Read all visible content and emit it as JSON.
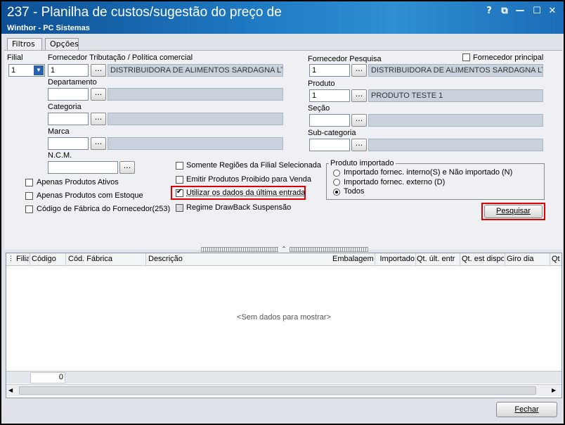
{
  "window": {
    "title": "237 - Planilha de custos/sugestão do preço de",
    "subtitle": "Winthor - PC Sistemas",
    "buttons": [
      "?",
      "⧉",
      "—",
      "☐",
      "✕"
    ]
  },
  "tabs": [
    {
      "label": "Filtros"
    },
    {
      "label": "Opções"
    }
  ],
  "filters": {
    "filial_label": "Filial",
    "filial_value": "1",
    "forn_trib_label": "Fornecedor Tributação / Política comercial",
    "forn_trib_code": "1",
    "forn_trib_name": "DISTRIBUIDORA DE ALIMENTOS SARDAGNA LTDA",
    "departamento_label": "Departamento",
    "categoria_label": "Categoria",
    "marca_label": "Marca",
    "ncm_label": "N.C.M.",
    "forn_pesq_label": "Fornecedor Pesquisa",
    "forn_pesq_code": "1",
    "forn_pesq_name": "DISTRIBUIDORA DE ALIMENTOS SARDAGNA LTDA",
    "forn_principal_label": "Fornecedor principal",
    "produto_label": "Produto",
    "produto_code": "1",
    "produto_name": "PRODUTO TESTE 1",
    "secao_label": "Seção",
    "subcategoria_label": "Sub-categoria",
    "ellipsis": "..."
  },
  "checkboxes": {
    "apenas_ativos": "Apenas Produtos Ativos",
    "apenas_estoque": "Apenas Produtos com Estoque",
    "codigo_fabrica": "Código de Fábrica do Fornecedor(253)",
    "somente_regioes": "Somente Regiões da Filial Selecionada",
    "emitir_proibido": "Emitir Produtos Proibido para Venda",
    "utilizar_ultima": "Utilizar os dados da última entrada",
    "regime_drawback": "Regime DrawBack Suspensão"
  },
  "produto_importado": {
    "title": "Produto importado",
    "options": [
      "Importado fornec. interno(S) e Não importado (N)",
      "Importado fornec. externo (D)",
      "Todos"
    ]
  },
  "pesquisar_label": "Pesquisar",
  "grid": {
    "columns": [
      "Filia",
      "Código",
      "Cód. Fábrica",
      "Descrição",
      "Embalagem",
      "Importado",
      "Qt. últ. entr",
      "Qt. est dispo",
      "Giro dia",
      "Qt"
    ],
    "empty_text": "<Sem dados para mostrar>",
    "footer_value": "0"
  },
  "fechar_label": "Fechar"
}
